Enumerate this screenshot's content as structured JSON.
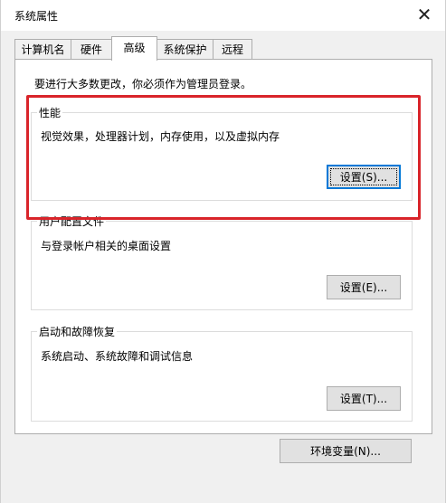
{
  "window": {
    "title": "系统属性"
  },
  "tabs": [
    {
      "label": "计算机名",
      "active": false
    },
    {
      "label": "硬件",
      "active": false
    },
    {
      "label": "高级",
      "active": true
    },
    {
      "label": "系统保护",
      "active": false
    },
    {
      "label": "远程",
      "active": false
    }
  ],
  "advanced": {
    "admin_note": "要进行大多数更改，你必须作为管理员登录。",
    "performance": {
      "title": "性能",
      "description": "视觉效果，处理器计划，内存使用，以及虚拟内存",
      "button": "设置(S)..."
    },
    "user_profiles": {
      "title": "用户配置文件",
      "description": "与登录帐户相关的桌面设置",
      "button": "设置(E)..."
    },
    "startup_recovery": {
      "title": "启动和故障恢复",
      "description": "系统启动、系统故障和调试信息",
      "button": "设置(T)..."
    },
    "env_button": "环境变量(N)..."
  },
  "colors": {
    "highlight": "#d9242a",
    "focus": "#0078d7"
  },
  "icons": {
    "close": "close-icon"
  }
}
